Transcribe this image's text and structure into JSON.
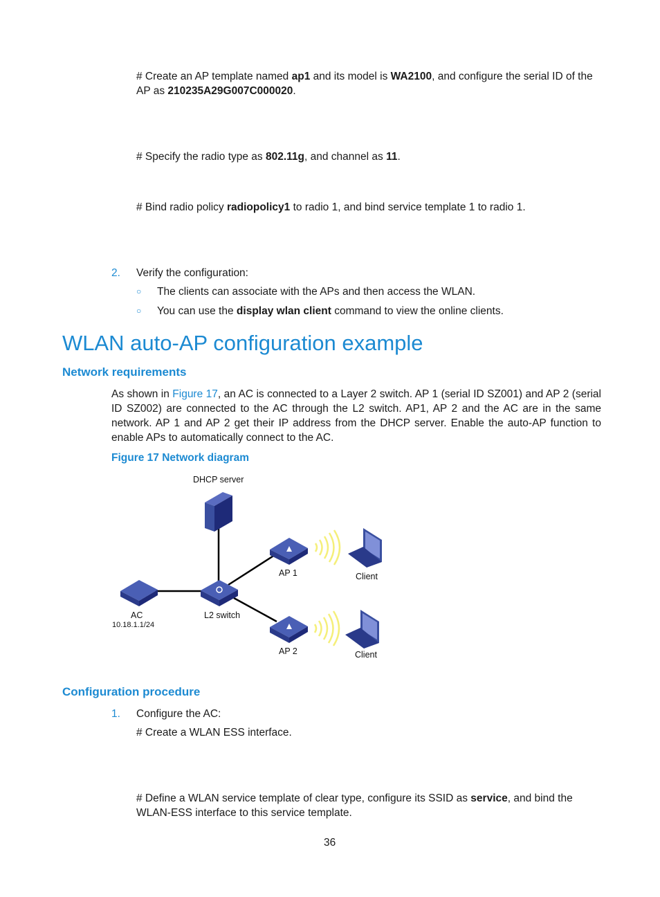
{
  "steps_top": [
    {
      "segments": [
        {
          "t": "# Create an AP template named "
        },
        {
          "t": "ap1",
          "b": true
        },
        {
          "t": " and its model is "
        },
        {
          "t": "WA2100",
          "b": true
        },
        {
          "t": ", and configure the serial ID of the"
        }
      ],
      "line2": [
        {
          "t": "AP as "
        },
        {
          "t": "210235A29G007C000020",
          "b": true
        },
        {
          "t": "."
        }
      ]
    },
    {
      "segments": [
        {
          "t": "# Specify the radio type as "
        },
        {
          "t": "802.11g",
          "b": true
        },
        {
          "t": ", and channel as "
        },
        {
          "t": "11",
          "b": true
        },
        {
          "t": "."
        }
      ]
    },
    {
      "segments": [
        {
          "t": "# Bind radio policy "
        },
        {
          "t": "radiopolicy1",
          "b": true
        },
        {
          "t": " to radio 1, and bind service template 1 to radio 1."
        }
      ]
    }
  ],
  "verify": {
    "number": "2.",
    "text": "Verify the configuration:",
    "bullet": "○",
    "items": [
      [
        {
          "t": "The clients can associate with the APs and then access the WLAN."
        }
      ],
      [
        {
          "t": "You can use the "
        },
        {
          "t": "display wlan client",
          "b": true
        },
        {
          "t": " command to view the online clients."
        }
      ]
    ]
  },
  "section_title": "WLAN auto-AP configuration example",
  "network_requirements": {
    "title": "Network requirements",
    "para": [
      {
        "t": "As shown in "
      },
      {
        "t": "Figure 17",
        "link": true
      },
      {
        "t": ", an AC is connected to a Layer 2 switch. AP 1 (serial ID SZ001) and AP 2 (serial ID SZ002) are connected to the AC through the L2 switch. AP1, AP 2 and the AC are in the same network. AP 1 and AP 2 get their IP address from the DHCP server. Enable the auto-AP function to enable APs to automatically connect to the AC."
      }
    ]
  },
  "figure": {
    "caption": "Figure 17 Network diagram",
    "labels": {
      "dhcp": "DHCP server",
      "ap1": "AP 1",
      "ap2": "AP 2",
      "client1": "Client",
      "client2": "Client",
      "ac": "AC",
      "ac_ip": "10.18.1.1/24",
      "switch": "L2 switch"
    }
  },
  "configuration_procedure": {
    "title": "Configuration procedure",
    "number": "1.",
    "step": "Configure the AC:",
    "line1": "# Create a WLAN ESS interface.",
    "line2": [
      {
        "t": "# Define a WLAN service template of clear type, configure its SSID as "
      },
      {
        "t": "service",
        "b": true
      },
      {
        "t": ", and bind the"
      }
    ],
    "line3": "WLAN-ESS interface to this service template."
  },
  "page_number": "36",
  "colors": {
    "heading": "#1c8ad2",
    "device": "#3a4fa0",
    "wireless": "#f5ef7a"
  }
}
